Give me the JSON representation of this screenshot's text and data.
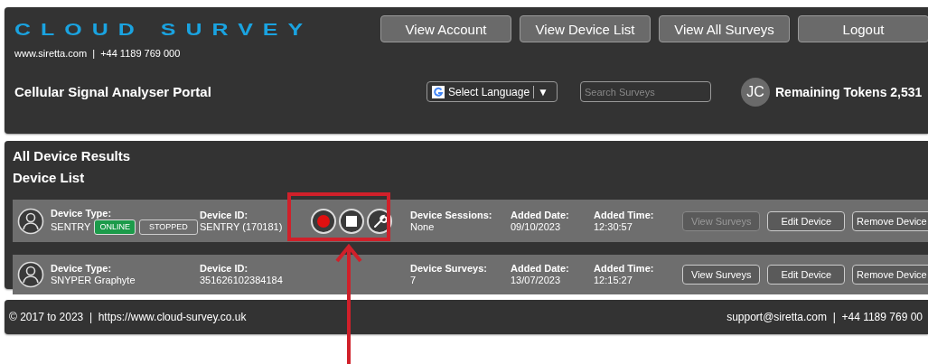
{
  "header": {
    "logo": "CLOUD SURVEY",
    "contact": "www.siretta.com  |  +44 1189 769 000",
    "portal_title": "Cellular Signal Analyser Portal",
    "nav_buttons": [
      "View Account",
      "View Device List",
      "View All Surveys",
      "Logout"
    ],
    "language_select": {
      "label": "Select Language",
      "caret": "▼"
    },
    "search": {
      "placeholder": "Search Surveys"
    },
    "avatar": "JC",
    "tokens_label": "Remaining Tokens",
    "tokens_value": "2,531"
  },
  "results": {
    "title": "All Device Results",
    "subtitle": "Device List",
    "devices": [
      {
        "type_label": "Device Type:",
        "type": "SENTRY",
        "statuses": [
          {
            "label": "ONLINE",
            "kind": "online"
          },
          {
            "label": "STOPPED",
            "kind": "stopped"
          }
        ],
        "id_label": "Device ID:",
        "id": "SENTRY (170181)",
        "controls": [
          {
            "kind": "record"
          },
          {
            "kind": "stop"
          },
          {
            "kind": "settings"
          }
        ],
        "count_label": "Device Sessions:",
        "count": "None",
        "date_label": "Added Date:",
        "date": "09/10/2023",
        "time_label": "Added Time:",
        "time": "12:30:57",
        "buttons": [
          {
            "label": "View Surveys",
            "disabled": true
          },
          {
            "label": "Edit Device",
            "disabled": false
          },
          {
            "label": "Remove Device",
            "disabled": false
          }
        ]
      },
      {
        "type_label": "Device Type:",
        "type": "SNYPER Graphyte",
        "id_label": "Device ID:",
        "id": "351626102384184",
        "count_label": "Device Surveys:",
        "count": "7",
        "date_label": "Added Date:",
        "date": "13/07/2023",
        "time_label": "Added Time:",
        "time": "12:15:27",
        "buttons": [
          {
            "label": "View Surveys",
            "disabled": false
          },
          {
            "label": "Edit Device",
            "disabled": false
          },
          {
            "label": "Remove Device",
            "disabled": false
          }
        ]
      }
    ]
  },
  "footer": {
    "left": "© 2017 to 2023  |  https://www.cloud-survey.co.uk",
    "right": "support@siretta.com  |  +44 1189 769 00"
  },
  "annotation": {
    "kind": "highlight"
  }
}
